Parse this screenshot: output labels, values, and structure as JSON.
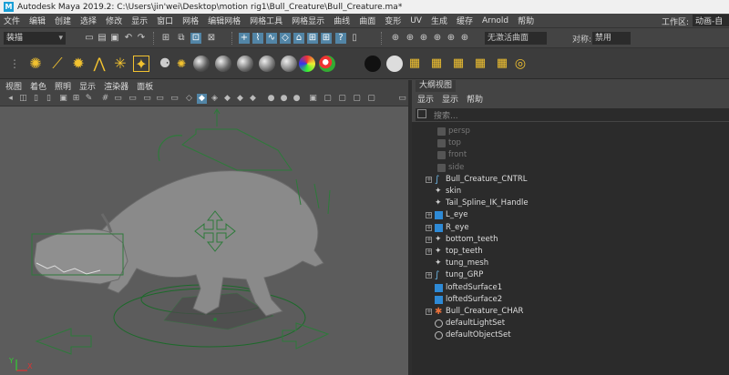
{
  "title_bar": {
    "text": "Autodesk Maya 2019.2: C:\\Users\\jin'wei\\Desktop\\motion rig1\\Bull_Creature\\Bull_Creature.ma*",
    "logo_letter": "M"
  },
  "menubar": {
    "items": [
      "文件",
      "编辑",
      "创建",
      "选择",
      "修改",
      "显示",
      "窗口",
      "网格",
      "编辑网格",
      "网格工具",
      "网格显示",
      "曲线",
      "曲面",
      "变形",
      "UV",
      "生成",
      "缓存",
      "Arnold",
      "帮助"
    ],
    "workspace_label": "工作区:",
    "workspace_value": "动画-自"
  },
  "statusline": {
    "menuset": "装描",
    "live_surface": "无激活曲面",
    "symmetry_label": "对称:",
    "symmetry_value": "禁用"
  },
  "shelf": {
    "sphere_colors": [
      "#5a5a5a",
      "#666666",
      "#707070",
      "#7a7a7a",
      "#858585",
      "#909090",
      "#9a9a9a",
      "#111111",
      "#dddddd"
    ]
  },
  "viewport": {
    "menu": [
      "视图",
      "着色",
      "照明",
      "显示",
      "渲染器",
      "面板"
    ],
    "axis": {
      "x": "X",
      "y": "Y"
    }
  },
  "outliner": {
    "title": "大纲视图",
    "menu": [
      "显示",
      "显示",
      "帮助"
    ],
    "search_placeholder": "搜索...",
    "items": [
      {
        "label": "persp",
        "icon": "camera-icon",
        "dim": true,
        "expand": false,
        "indent": 0
      },
      {
        "label": "top",
        "icon": "camera-icon",
        "dim": true,
        "expand": false,
        "indent": 0
      },
      {
        "label": "front",
        "icon": "camera-icon",
        "dim": true,
        "expand": false,
        "indent": 0
      },
      {
        "label": "side",
        "icon": "camera-icon",
        "dim": true,
        "expand": false,
        "indent": 0
      },
      {
        "label": "Bull_Creature_CNTRL",
        "icon": "curve-icon",
        "dim": false,
        "expand": true,
        "indent": 0
      },
      {
        "label": "skin",
        "icon": "joint-icon",
        "dim": false,
        "expand": false,
        "indent": 0
      },
      {
        "label": "Tail_Spline_IK_Handle",
        "icon": "ik-handle-icon",
        "dim": false,
        "expand": false,
        "indent": 0
      },
      {
        "label": "L_eye",
        "icon": "surface-icon",
        "dim": false,
        "expand": true,
        "indent": 0
      },
      {
        "label": "R_eye",
        "icon": "surface-icon",
        "dim": false,
        "expand": true,
        "indent": 0
      },
      {
        "label": "bottom_teeth",
        "icon": "group-icon",
        "dim": false,
        "expand": true,
        "indent": 0
      },
      {
        "label": "top_teeth",
        "icon": "group-icon",
        "dim": false,
        "expand": true,
        "indent": 0
      },
      {
        "label": "tung_mesh",
        "icon": "group-icon",
        "dim": false,
        "expand": false,
        "indent": 0
      },
      {
        "label": "tung_GRP",
        "icon": "curve-icon",
        "dim": false,
        "expand": true,
        "indent": 0
      },
      {
        "label": "loftedSurface1",
        "icon": "surface-icon",
        "dim": false,
        "expand": false,
        "indent": 0
      },
      {
        "label": "loftedSurface2",
        "icon": "surface-icon",
        "dim": false,
        "expand": false,
        "indent": 0
      },
      {
        "label": "Bull_Creature_CHAR",
        "icon": "character-set-icon",
        "dim": false,
        "expand": true,
        "indent": 0
      },
      {
        "label": "defaultLightSet",
        "icon": "set-icon",
        "dim": false,
        "expand": false,
        "indent": 0
      },
      {
        "label": "defaultObjectSet",
        "icon": "set-icon",
        "dim": false,
        "expand": false,
        "indent": 0
      }
    ]
  }
}
